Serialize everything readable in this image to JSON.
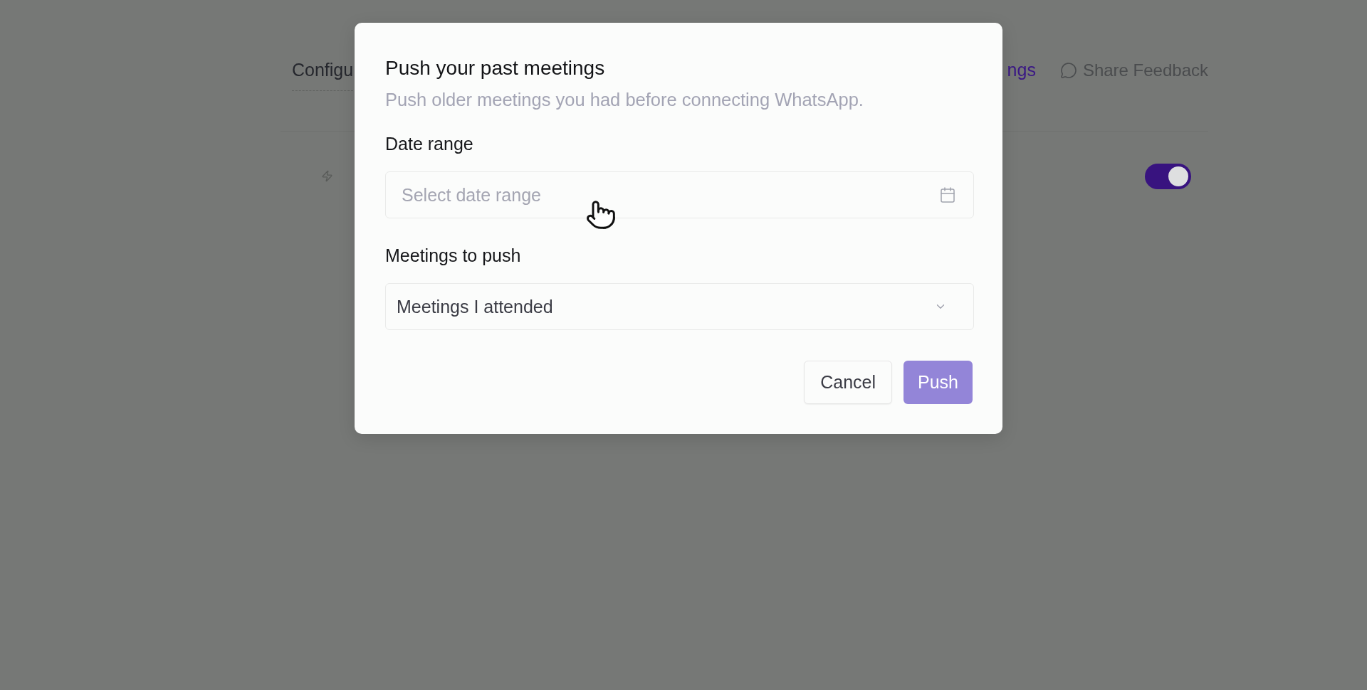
{
  "background_page": {
    "tabs": [
      {
        "label": "Configu",
        "selected": false
      },
      {
        "label": "ngs",
        "selected": true
      }
    ],
    "feedback_link": {
      "label": "Share Feedback"
    },
    "setting_row": {
      "toggle": {
        "on": true
      }
    }
  },
  "dialog": {
    "title": "Push your past meetings",
    "description": "Push older meetings you had before connecting WhatsApp.",
    "fields": [
      {
        "kind": "date",
        "label": "Date range",
        "placeholder": "Select date range"
      },
      {
        "kind": "select",
        "label": "Meetings to push",
        "value": "Meetings I attended"
      }
    ],
    "buttons": [
      {
        "label": "Cancel",
        "kind": "secondary",
        "disabled": false
      },
      {
        "label": "Push",
        "kind": "primary",
        "disabled": true
      }
    ]
  }
}
